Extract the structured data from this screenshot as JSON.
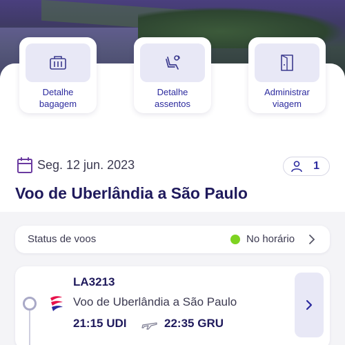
{
  "actions": [
    {
      "label_line1": "Detalhe",
      "label_line2": "bagagem",
      "icon": "luggage-icon"
    },
    {
      "label_line1": "Detalhe",
      "label_line2": "assentos",
      "icon": "seat-icon"
    },
    {
      "label_line1": "Administrar",
      "label_line2": "viagem",
      "icon": "manage-trip-icon"
    }
  ],
  "trip": {
    "date": "Seg. 12 jun. 2023",
    "passengers": "1",
    "title": "Voo de Uberlândia a São Paulo"
  },
  "status": {
    "label": "Status de voos",
    "value": "No horário",
    "indicator_color": "#7ed321"
  },
  "flight": {
    "code": "LA3213",
    "route": "Voo de Uberlândia a São Paulo",
    "departure_time": "21:15",
    "departure_airport": "UDI",
    "arrival_time": "22:35",
    "arrival_airport": "GRU"
  },
  "colors": {
    "accent": "#2b2a9e",
    "title": "#1f1a5c",
    "chip_bg": "#e8e8f6"
  }
}
